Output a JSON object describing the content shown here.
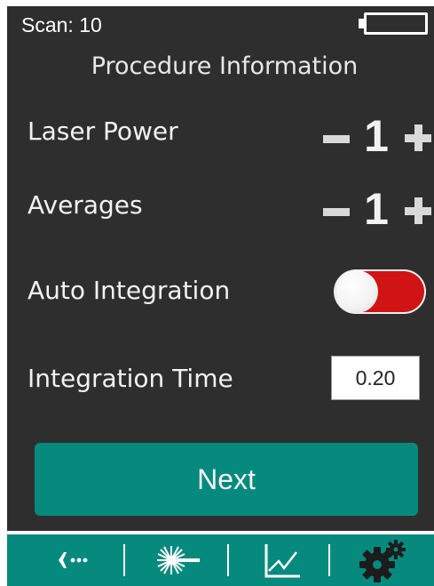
{
  "status": {
    "scan_label": "Scan: 10",
    "battery_icon": "battery-icon"
  },
  "title": "Procedure Information",
  "settings": {
    "laser_power": {
      "label": "Laser Power",
      "value": "1"
    },
    "averages": {
      "label": "Averages",
      "value": "1"
    },
    "auto_integration": {
      "label": "Auto Integration",
      "enabled": false
    },
    "integration_time": {
      "label": "Integration Time",
      "value": "0.20"
    }
  },
  "next_label": "Next",
  "nav": {
    "items": [
      "back-icon",
      "laser-icon",
      "graph-icon",
      "settings-gear-icon"
    ]
  },
  "colors": {
    "accent": "#078a7e",
    "screen_bg": "#2e2e2e",
    "toggle": "#d01313"
  }
}
